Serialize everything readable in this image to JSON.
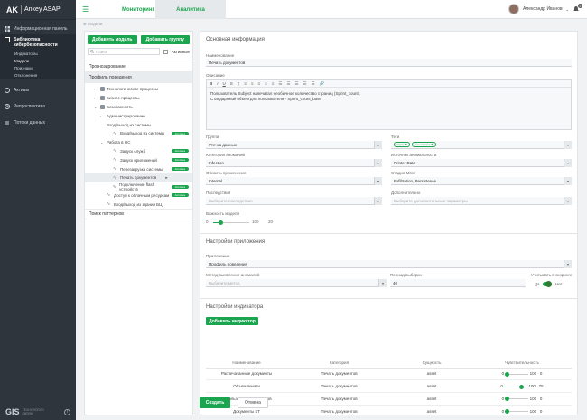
{
  "sidebar": {
    "brand": "AK",
    "product": "Ankey ASAP",
    "items": [
      {
        "label": "Информационная панель"
      },
      {
        "label": "Библиотека кибербезопасности"
      },
      {
        "label": "Активы"
      },
      {
        "label": "Репроспектива"
      },
      {
        "label": "Потоки данных"
      }
    ],
    "subitems": [
      "Индикаторы",
      "Модели",
      "Признаки",
      "Отклонения"
    ],
    "footer": {
      "logo": "GIS",
      "sub1": "ТЕХНОЛОГИИ",
      "sub2": "СВЯЗИ",
      "info": "i"
    }
  },
  "topbar": {
    "tabs": [
      "Мониторинг",
      "Аналитика"
    ],
    "user": "Александр Иванов",
    "notifications": "0"
  },
  "breadcrumb": "⊕ Модели",
  "left": {
    "add_model": "Добавить модель",
    "add_group": "Добавить группу",
    "search_placeholder": "Поиск",
    "active_label": "Активные",
    "rows": [
      "Прогнозирование",
      "Профиль поведения"
    ],
    "tree": [
      {
        "label": "Технологические процессы",
        "indent": 0,
        "toggle": "›",
        "icon": "db"
      },
      {
        "label": "Бизнес-процессы",
        "indent": 0,
        "toggle": "›",
        "icon": "db"
      },
      {
        "label": "Безопасность",
        "indent": 0,
        "toggle": "⌄",
        "icon": "db"
      },
      {
        "label": "Администрирование",
        "indent": 1,
        "toggle": "›",
        "icon": ""
      },
      {
        "label": "Вход/выход из системы",
        "indent": 1,
        "toggle": "⌄",
        "icon": ""
      },
      {
        "label": "Вход/выход из системы",
        "indent": 2,
        "toggle": "",
        "icon": "pulse",
        "tag": "Активна"
      },
      {
        "label": "Работа в ОС",
        "indent": 1,
        "toggle": "⌄",
        "icon": ""
      },
      {
        "label": "Запуск служб",
        "indent": 2,
        "toggle": "",
        "icon": "pulse",
        "tag": "Активна"
      },
      {
        "label": "Запуск приложений",
        "indent": 2,
        "toggle": "",
        "icon": "pulse",
        "tag": "Активна"
      },
      {
        "label": "Перезагрузка системы",
        "indent": 2,
        "toggle": "",
        "icon": "pulse",
        "tag": "Активна"
      },
      {
        "label": "Печать документов",
        "indent": 2,
        "toggle": "",
        "icon": "pulse",
        "tag": "",
        "hl": true
      },
      {
        "label": "Подключение flash устройств",
        "indent": 2,
        "toggle": "",
        "icon": "pulse",
        "tag": "Активна"
      },
      {
        "label": "Доступ к облачным ресурсам",
        "indent": 1,
        "toggle": "",
        "icon": "pulse",
        "tag": "Активна"
      },
      {
        "label": "Вход/выход из здания БЦ",
        "indent": 1,
        "toggle": "",
        "icon": "pulse",
        "tag": ""
      }
    ],
    "bottom_row": "Поиск паттернов"
  },
  "form": {
    "basic_title": "Основная информация",
    "name_label": "Наименование",
    "name_value": "Печать документов",
    "desc_label": "Описание",
    "toolbar": [
      "B",
      "I",
      "U",
      "S",
      "¶",
      "≡",
      "≡",
      "≡",
      "≡",
      "≡",
      "☰",
      "☰",
      "☰",
      "☰",
      "☰",
      "🔗"
    ],
    "desc_line1": "Пользователь Subject напечатал необычное количество страниц {Sprint_count}.",
    "desc_line2": "Стандартный объем для пользователя - Sprint_count_base",
    "group_label": "Группа",
    "group_value": "Утечка данных",
    "tags_label": "Теги",
    "tags": [
      "printer ✖",
      "пользовател ✖"
    ],
    "anomaly_label": "Категория аномалий",
    "anomaly_value": "Infection",
    "source_label": "Источник аномальности",
    "source_value": "Printer Data",
    "area_label": "Область применения",
    "area_value": "Internal",
    "mitre_label": "Стадия Mitre",
    "mitre_value": "Exfiltration, Persistence",
    "consequence_label": "Последствия",
    "consequence_placeholder": "Выберите последствия",
    "extra_label": "Дополнительно",
    "extra_placeholder": "Выберите дополнительные параметры",
    "importance_label": "Важность модели",
    "importance_min": "0",
    "importance_max": "100",
    "importance_value": "20",
    "app_title": "Настройки приложения",
    "app_label": "Приложение",
    "app_value": "Профиль поведения",
    "method_label": "Метод выявления аномалий",
    "method_placeholder": "Выберите метод",
    "period_label": "Период выборки",
    "period_value": "40",
    "scoring_label": "Учитывать в скоринге",
    "scoring_yes": "Да",
    "scoring_no": "Нет",
    "ind_title": "Настройки индикатора",
    "add_indicator": "Добавить индикатор",
    "columns": [
      "Наименование",
      "Категория",
      "Сущность",
      "Чувствительность"
    ],
    "indicators": [
      {
        "name": "Распечатанные документы",
        "category": "Печать документов",
        "entity": "asset",
        "min": "0",
        "max": "100",
        "value": "0",
        "sens": 0.1
      },
      {
        "name": "Объем печати",
        "category": "Печать документов",
        "entity": "asset",
        "min": "0",
        "max": "100",
        "value": "75",
        "sens": 0.75
      },
      {
        "name": "Использование принтеров",
        "category": "Печать документов",
        "entity": "asset",
        "min": "0",
        "max": "100",
        "value": "0",
        "sens": 0.1
      },
      {
        "name": "Документы КТ",
        "category": "Печать документов",
        "entity": "asset",
        "min": "0",
        "max": "100",
        "value": "0",
        "sens": 0.1
      }
    ],
    "create": "Создать",
    "cancel": "Отмена"
  }
}
